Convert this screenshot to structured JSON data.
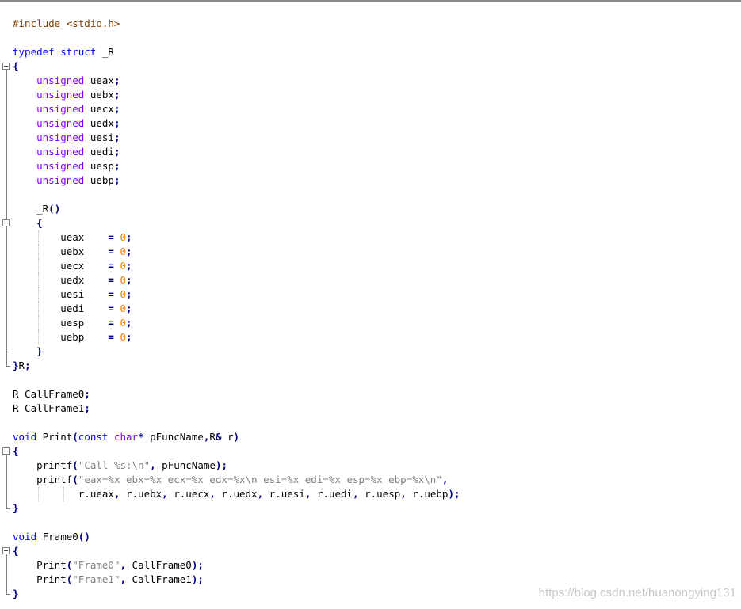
{
  "code_lines": [
    "#include <stdio.h>",
    "",
    "typedef struct _R",
    "{",
    "    unsigned ueax;",
    "    unsigned uebx;",
    "    unsigned uecx;",
    "    unsigned uedx;",
    "    unsigned uesi;",
    "    unsigned uedi;",
    "    unsigned uesp;",
    "    unsigned uebp;",
    "",
    "    _R()",
    "    {",
    "        ueax    = 0;",
    "        uebx    = 0;",
    "        uecx    = 0;",
    "        uedx    = 0;",
    "        uesi    = 0;",
    "        uedi    = 0;",
    "        uesp    = 0;",
    "        uebp    = 0;",
    "    }",
    "}R;",
    "",
    "R CallFrame0;",
    "R CallFrame1;",
    "",
    "void Print(const char* pFuncName,R& r)",
    "{",
    "    printf(\"Call %s:\\n\", pFuncName);",
    "    printf(\"eax=%x ebx=%x ecx=%x edx=%x\\n esi=%x edi=%x esp=%x ebp=%x\\n\",",
    "           r.ueax, r.uebx, r.uecx, r.uedx, r.uesi, r.uedi, r.uesp, r.uebp);",
    "}",
    "",
    "void Frame0()",
    "{",
    "    Print(\"Frame0\", CallFrame0);",
    "    Print(\"Frame1\", CallFrame1);",
    "}"
  ],
  "watermark": "https://blog.csdn.net/huanongying131",
  "colors": {
    "keyword": "#0000ff",
    "type": "#8000ff",
    "preprocessor": "#804000",
    "number": "#ff8000",
    "string": "#808080",
    "operator": "#000080",
    "current_line": "#e8e8ff"
  },
  "icons": [
    "fold-minus-icon",
    "fold-end-icon"
  ]
}
